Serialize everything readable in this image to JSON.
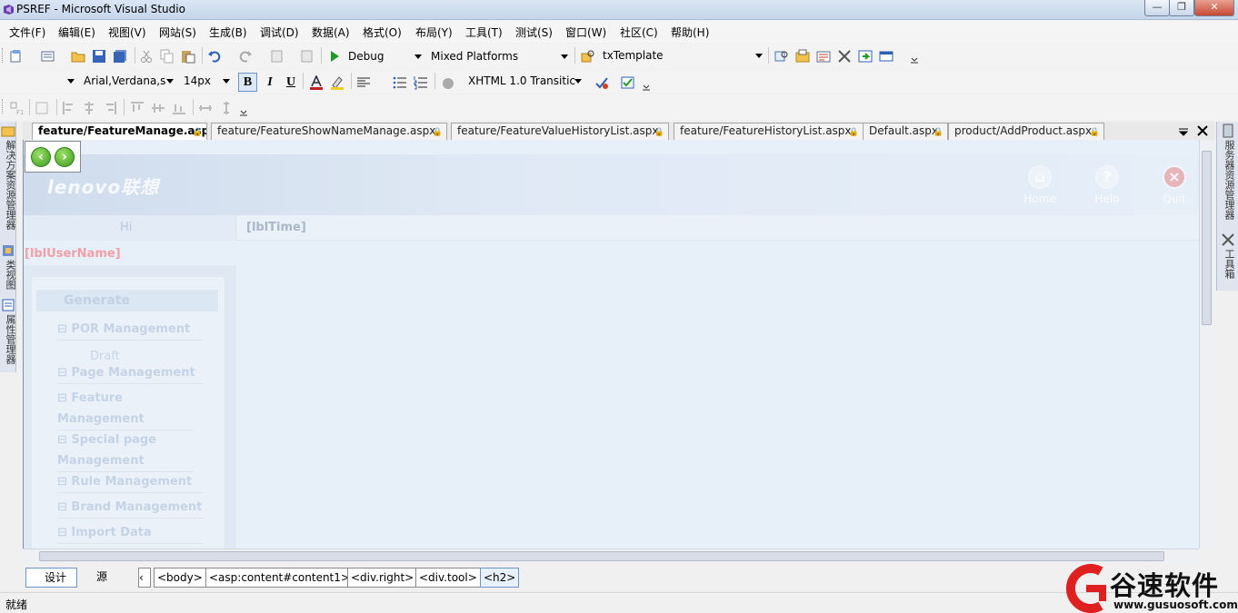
{
  "window": {
    "title": "PSREF - Microsoft Visual Studio"
  },
  "menu": [
    "文件(F)",
    "编辑(E)",
    "视图(V)",
    "网站(S)",
    "生成(B)",
    "调试(D)",
    "数据(A)",
    "格式(O)",
    "布局(Y)",
    "工具(T)",
    "测试(S)",
    "窗口(W)",
    "社区(C)",
    "帮助(H)"
  ],
  "toolbar1": {
    "config": "Debug",
    "platform": "Mixed Platforms",
    "find": "txTemplate"
  },
  "toolbar2": {
    "style": "",
    "font": "Arial,Verdana,s",
    "size": "14px",
    "bold": "B",
    "italic": "I",
    "underline": "U",
    "doctype": "XHTML 1.0 Transitic"
  },
  "left_panel": {
    "solution_explorer": "解决方案资源管理器",
    "class_view": "类视图",
    "property_manager": "属性管理器"
  },
  "right_panel": {
    "server_explorer": "服务器资源管理器",
    "toolbox": "工具箱"
  },
  "tabs": [
    "feature/FeatureManage.aspx",
    "feature/FeatureShowNameManage.aspx",
    "feature/FeatureValueHistoryList.aspx",
    "feature/FeatureHistoryList.aspx",
    "Default.aspx",
    "product/AddProduct.aspx"
  ],
  "active_tab": 0,
  "page": {
    "logo": "lenovo联想",
    "nav": [
      "Home",
      "Help",
      "Quit"
    ],
    "hi": "Hi",
    "lbl_time": "[lblTime]",
    "lbl_user": "[lblUserName]",
    "menu_head": "Generate",
    "menu_items": [
      "POR Management",
      "Page Management",
      "Feature Management",
      "Special page Management",
      "Rule Management",
      "Brand Management",
      "Import Data"
    ],
    "sub_item": "Draft"
  },
  "viewbar": {
    "design": "设计",
    "source": "源",
    "crumbs": [
      "<body>",
      "<asp:content#content1>",
      "<div.right>",
      "<div.tool>",
      "<h2>"
    ]
  },
  "status": "就绪",
  "watermark": {
    "brand": "谷速软件",
    "url": "www.gusuosoft.com"
  }
}
